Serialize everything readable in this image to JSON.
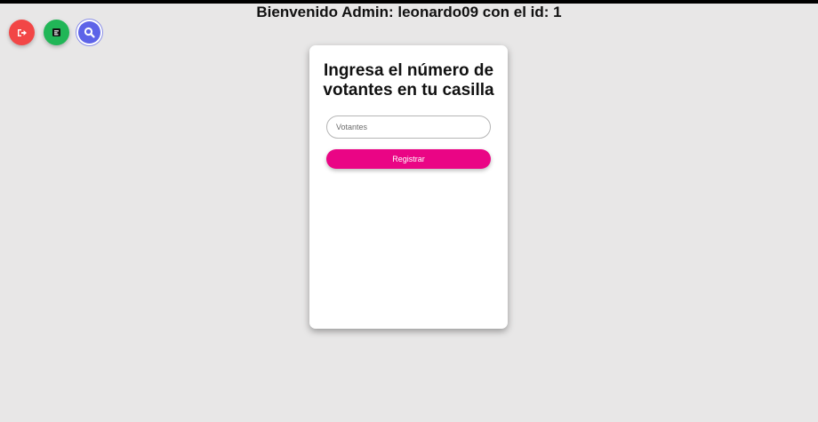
{
  "header": {
    "welcome_text": "Bienvenido Admin: leonardo09 con el id: 1"
  },
  "actions": [
    {
      "name": "logout",
      "icon": "logout-icon",
      "color": "#f24646"
    },
    {
      "name": "report",
      "icon": "report-icon",
      "color": "#21b657"
    },
    {
      "name": "search",
      "icon": "search-icon",
      "color": "#5d63e8"
    }
  ],
  "form": {
    "title": "Ingresa el número de votantes en tu casilla",
    "input_placeholder": "Votantes",
    "input_value": "",
    "submit_label": "Registrar",
    "submit_color": "#ea0585"
  }
}
